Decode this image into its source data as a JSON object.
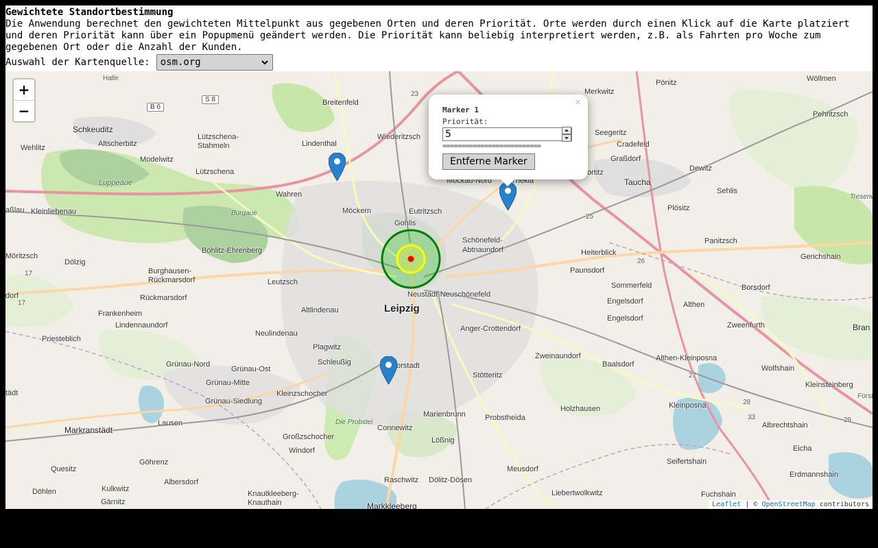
{
  "header": {
    "title": "Gewichtete Standortbestimmung",
    "description": "Die Anwendung berechnet den gewichteten Mittelpunkt aus gegebenen Orten und deren Priorität. Orte werden durch einen Klick auf die Karte platziert und deren Priorität kann über ein Popupmenü geändert werden. Die Priorität kann beliebig interpretiert werden, z.B. als Fahrten pro Woche zum gegebenen Ort oder die Anzahl der Kunden."
  },
  "map_source": {
    "label": "Auswahl der Kartenquelle:",
    "selected": "osm.org"
  },
  "zoom": {
    "in_label": "+",
    "out_label": "−"
  },
  "popup": {
    "title": "Marker 1",
    "priority_label": "Priorität:",
    "priority_value": "5",
    "separator": "==========================",
    "remove_label": "Entferne Marker",
    "close_label": "×"
  },
  "attribution": {
    "leaflet": "Leaflet",
    "sep": " | © ",
    "osm": "OpenStreetMap",
    "suffix": " contributors"
  },
  "colors": {
    "marker": "#2A81CB",
    "circle_outer": "#008000",
    "circle_inner": "#ffff00",
    "center": "#ff0000"
  },
  "map_labels": {
    "leipzig": "Leipzig",
    "schkeuditz": "Schkeuditz",
    "altscherbitz": "Altscherbitz",
    "wehlitz": "Wehlitz",
    "modelwitz": "Modelwitz",
    "luppeaue": "Luppeaue",
    "luetzschena_stahmeln": "Lützschena-\nStahmeln",
    "luetzschena": "Lützschena",
    "lindenthal": "Lindenthal",
    "breitenfeld": "Breitenfeld",
    "wiederitzsch": "Wiederitzsch",
    "wahren": "Wahren",
    "moeckern": "Möckern",
    "eutritzsch": "Eutritzsch",
    "gohlis": "Gohlis",
    "burgaue": "Burgaue",
    "kleinliebenau": "Kleinliebenau",
    "dassslau": "aßlau",
    "boehlitz_ehrenberg": "Böhlitz-Ehrenberg",
    "moritzsch": "Möritzsch",
    "doelzig": "Dölzig",
    "burghausen": "Burghausen-\nRückmarsdorf",
    "leutzsch": "Leutzsch",
    "rueckmarsdorf": "Rückmarsdorf",
    "dorf": "dorf",
    "frankenheim": "Frankenheim",
    "lindennaundorf": "Lindennaundorf",
    "altlindenau": "Altlindenau",
    "neulindenau": "Neulindenau",
    "priesteblich": "Priesteblich",
    "plagwitz": "Plagwitz",
    "schleussig": "Schleußig",
    "gruenau_nord": "Grünau-Nord",
    "gruenau_ost": "Grünau-Ost",
    "gruenau_mitte": "Grünau-Mitte",
    "gruenau_siedlung": "Grünau-Siedlung",
    "kleinzschocher": "Kleinzschocher",
    "lausen": "Lausen",
    "stadt": "tädt",
    "markranstaedt": "Markranstädt",
    "grosszschocher": "Großzschocher",
    "windorf": "Windorf",
    "die_probstei": "Die Probstei",
    "connewitz": "Connewitz",
    "quesitz": "Quesitz",
    "goehrenz": "Göhrenz",
    "albersdorf": "Albersdorf",
    "kulkwitz": "Kulkwitz",
    "doehlen": "Döhlen",
    "gaernitz": "Gärnitz",
    "knautkleeberg": "Knautkleeberg-\nKnauthain",
    "markkleeberg": "Markkleeberg",
    "raschwitz": "Raschwitz",
    "doelitz": "Dölitz-Dösen",
    "loessnig": "Lößnig",
    "marienbrunn": "Marienbrunn",
    "probstheida": "Probstheida",
    "stoetteritz": "Stötteritz",
    "anger": "Anger-Crottendorf",
    "neustadt": "Neustadt-Neuschönefeld",
    "schoenefeld": "Schönefeld-\nAbtnaundorf",
    "mockau": "Mockau-Nord",
    "thekla": "Thekla",
    "paunsdorf": "Paunsdorf",
    "heiterblick": "Heiterblick",
    "sommerfeld": "Sommerfeld",
    "engelsdorf": "Engelsdorf",
    "zweinaundorf": "Zweinaundorf",
    "baalsdorf": "Baalsdorf",
    "holzhausen": "Holzhausen",
    "meusdorf": "Meusdorf",
    "liebertwolkwitz": "Liebertwolkwitz",
    "althen": "Althen",
    "althen_kleinposna": "Althen-Kleinposna",
    "kleinposna": "Kleinposna",
    "seifertshain": "Seifertshain",
    "fuchshain": "Fuchshain",
    "zweenfurth": "Zweenfurth",
    "wolfshain": "Wolfshain",
    "kleinsteinberg": "Kleinsteinberg",
    "albrechtshain": "Albrechtshain",
    "eicha": "Eicha",
    "erdmannshain": "Erdmannshain",
    "borsdorf": "Borsdorf",
    "gerichshain": "Gerichshain",
    "panitzsch": "Panitzsch",
    "ploesitz": "Plösitz",
    "sehlis": "Sehlis",
    "dewitz": "Dewitz",
    "taucha": "Taucha",
    "grassdorf": "Graßdorf",
    "cradefeld": "Cradefeld",
    "seegeritz": "Seegeritz",
    "merkwitz": "Merkwitz",
    "poenitz": "Pönitz",
    "woellmen": "Wöllmen",
    "pehritzsch": "Pehritzsch",
    "portitz": "ortitz",
    "bran": "Bran",
    "halle": "Halle",
    "forst": "Forst",
    "tresenwald": "Tresenwalde",
    "b6": "B 6",
    "s8": "S 8",
    "r23": "23",
    "r25": "25",
    "r26": "26",
    "r27": "27",
    "r28": "28",
    "r29": "29",
    "r33": "33",
    "r17a": "17",
    "r17b": "17",
    "gorstadt": "orstadt"
  }
}
